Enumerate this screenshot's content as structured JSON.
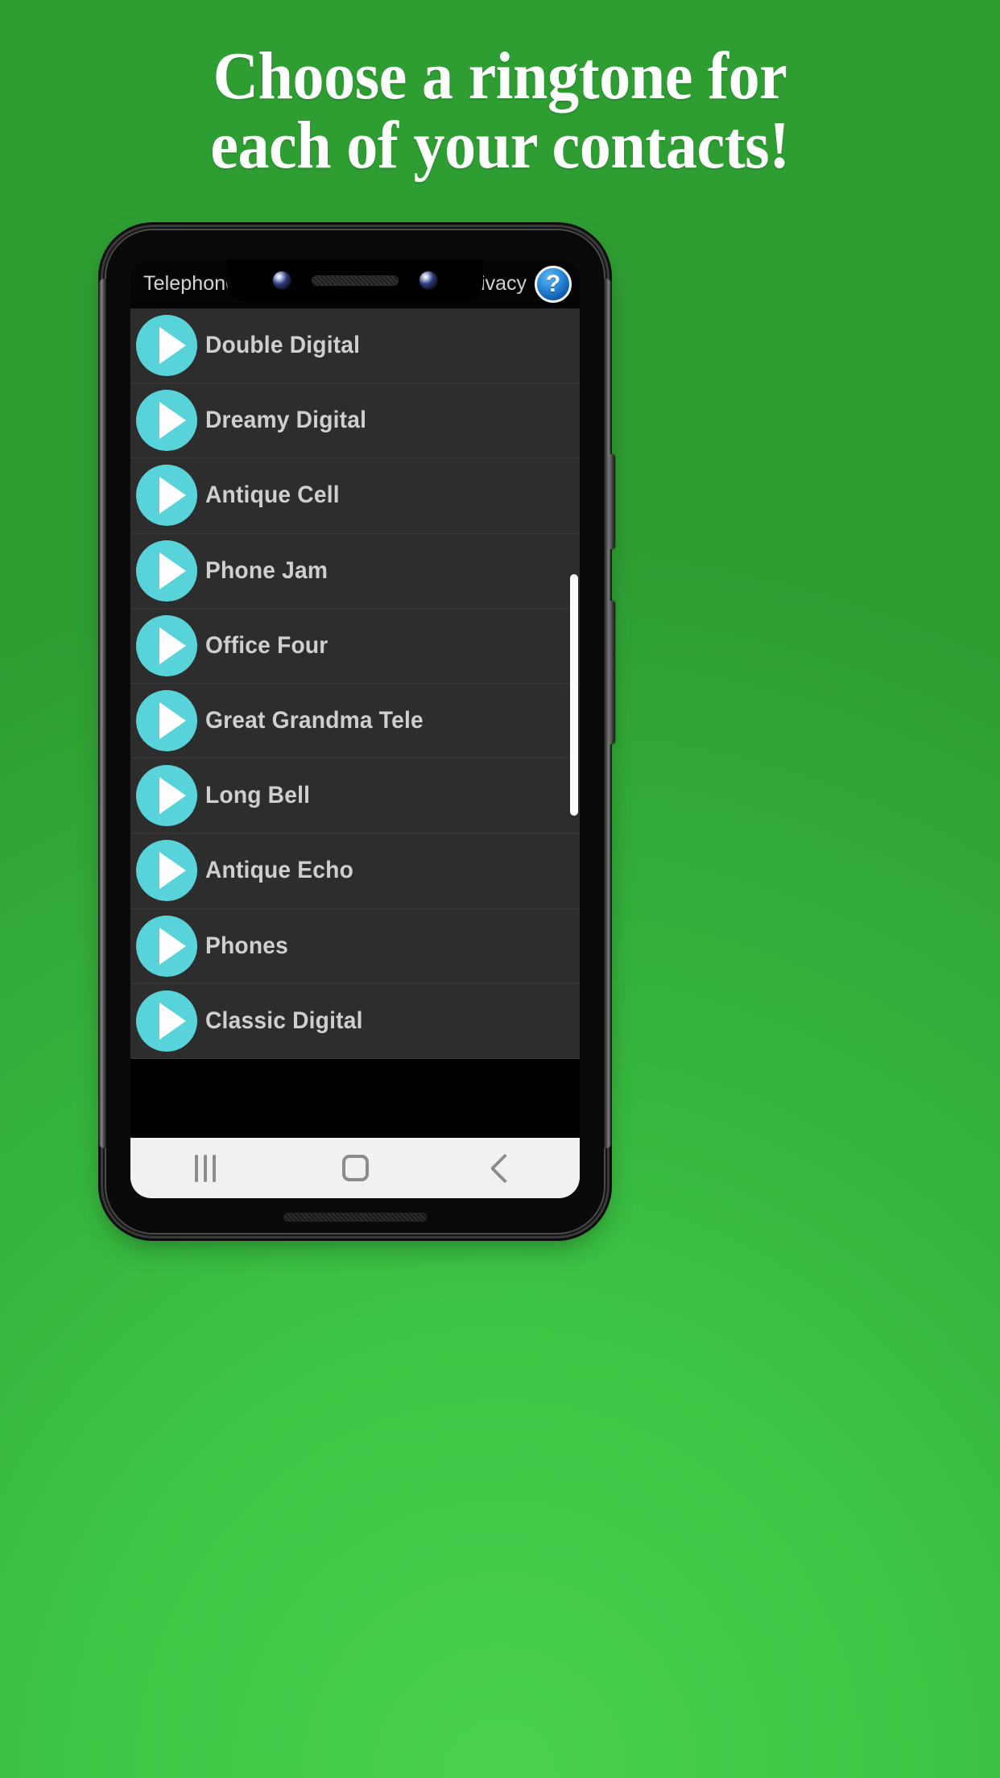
{
  "promo": {
    "headline_lines": [
      "Choose a ringtone for",
      "each of your contacts!"
    ],
    "background_color": "#3cc444",
    "headline_color": "#ffffff"
  },
  "app": {
    "title": "Telephone Ringt",
    "privacy_label": "Privacy",
    "help_icon_glyph": "?",
    "accent_color": "#58d3da",
    "surface_color": "#2d2d2d",
    "label_color": "#cfcfcf"
  },
  "ringtones": [
    {
      "name": "Double Digital",
      "play_icon": "play-icon"
    },
    {
      "name": "Dreamy Digital",
      "play_icon": "play-icon"
    },
    {
      "name": "Antique Cell",
      "play_icon": "play-icon"
    },
    {
      "name": "Phone Jam",
      "play_icon": "play-icon"
    },
    {
      "name": "Office Four",
      "play_icon": "play-icon"
    },
    {
      "name": "Great Grandma Tele",
      "play_icon": "play-icon"
    },
    {
      "name": "Long Bell",
      "play_icon": "play-icon"
    },
    {
      "name": "Antique Echo",
      "play_icon": "play-icon"
    },
    {
      "name": "Phones",
      "play_icon": "play-icon"
    },
    {
      "name": "Classic Digital",
      "play_icon": "play-icon"
    }
  ],
  "navbar": {
    "recents": "recents-icon",
    "home": "home-icon",
    "back": "back-icon"
  }
}
